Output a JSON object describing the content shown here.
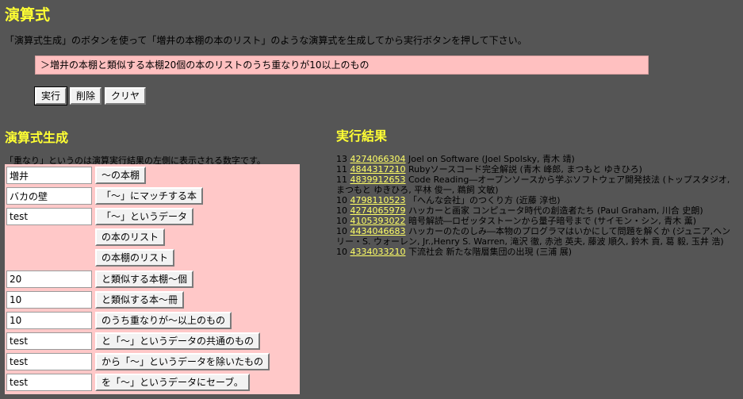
{
  "header": {
    "title": "演算式",
    "instructions": "「演算式生成」のボタンを使って「増井の本棚の本のリスト」のような演算式を生成してから実行ボタンを押して下さい。"
  },
  "expression": "＞増井の本棚と類似する本棚20個の本のリストのうち重なりが10以上のもの",
  "actions": {
    "run": "実行",
    "delete": "削除",
    "clear": "クリヤ"
  },
  "builder": {
    "title": "演算式生成",
    "note": "「重なり」というのは演算実行結果の左側に表示される数字です。",
    "rows": [
      {
        "input": "増井",
        "button": "〜の本棚"
      },
      {
        "input": "バカの壁",
        "button": "「〜」にマッチする本"
      },
      {
        "input": "test",
        "button": "「〜」というデータ"
      },
      {
        "input": null,
        "button": "の本のリスト"
      },
      {
        "input": null,
        "button": "の本棚のリスト"
      },
      {
        "input": "20",
        "button": "と類似する本棚〜個"
      },
      {
        "input": "10",
        "button": "と類似する本〜冊"
      },
      {
        "input": "10",
        "button": "のうち重なりが〜以上のもの"
      },
      {
        "input": "test",
        "button": "と「〜」というデータの共通のもの"
      },
      {
        "input": "test",
        "button": "から「〜」というデータを除いたもの"
      },
      {
        "input": "test",
        "button": "を「〜」というデータにセーブ。"
      }
    ]
  },
  "results": {
    "title": "実行結果",
    "items": [
      {
        "count": "13",
        "isbn": "4274066304",
        "text": "Joel on Software (Joel Spolsky, 青木 靖)"
      },
      {
        "count": "11",
        "isbn": "4844317210",
        "text": "Rubyソースコード完全解説 (青木 峰郎, まつもと ゆきひろ)"
      },
      {
        "count": "11",
        "isbn": "4839912653",
        "text": "Code Reading―オープンソースから学ぶソフトウェア開発技法 (トップスタジオ, まつもと ゆきひろ, 平林 俊一, 鵜飼 文敏)"
      },
      {
        "count": "10",
        "isbn": "4798110523",
        "text": "「へんな会社」のつくり方 (近藤 淳也)"
      },
      {
        "count": "10",
        "isbn": "4274065979",
        "text": "ハッカーと画家 コンピュータ時代の創造者たち (Paul Graham, 川合 史朗)"
      },
      {
        "count": "10",
        "isbn": "4105393022",
        "text": "暗号解読―ロゼッタストーンから量子暗号まで (サイモン・シン, 青木 薫)"
      },
      {
        "count": "10",
        "isbn": "4434046683",
        "text": "ハッカーのたのしみ―本物のプログラマはいかにして問題を解くか (ジュニア,ヘンリー・S. ウォーレン, Jr.,Henry S. Warren, 滝沢 徹, 赤池 英夫, 藤波 順久, 鈴木 貢, 葛 毅, 玉井 浩)"
      },
      {
        "count": "10",
        "isbn": "4334033210",
        "text": "下流社会 新たな階層集団の出現 (三浦 展)"
      }
    ]
  },
  "colors": {
    "background": "#555555",
    "heading": "#ffff33",
    "panel": "#ffc8c8",
    "link": "#ffff66"
  }
}
